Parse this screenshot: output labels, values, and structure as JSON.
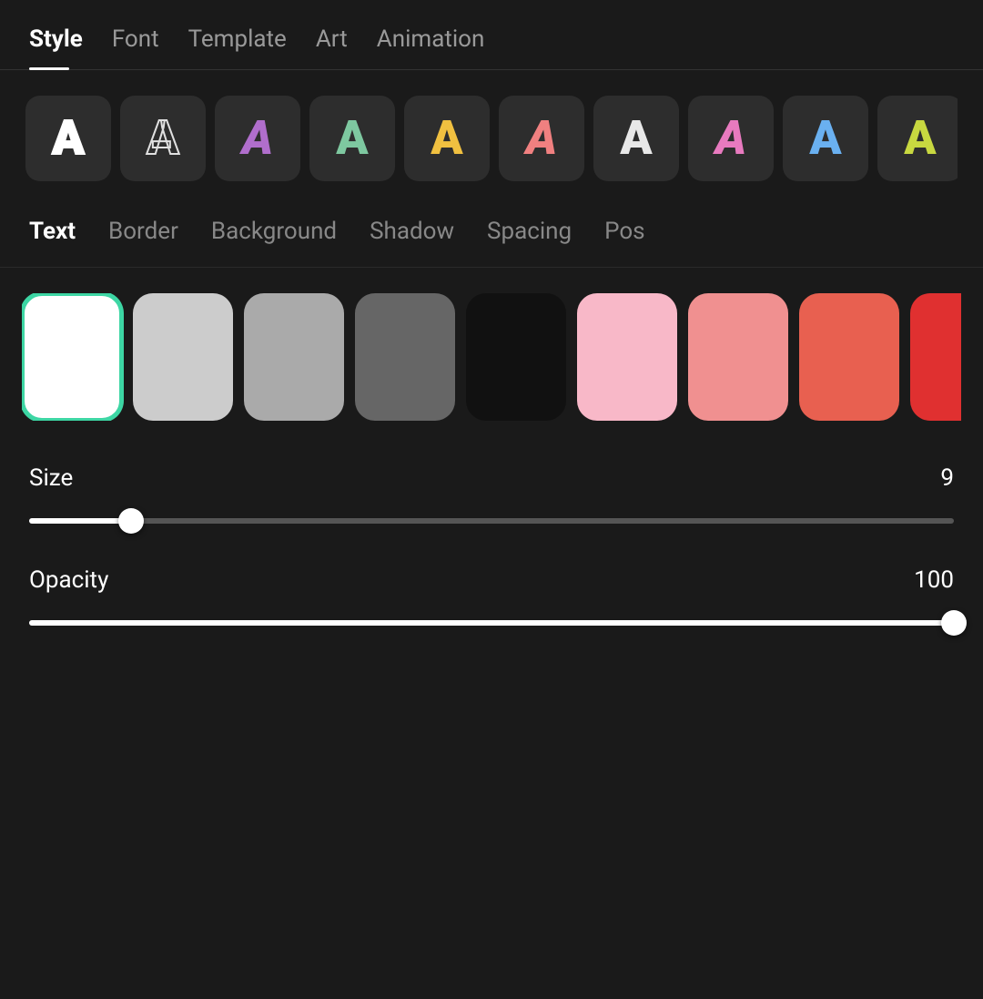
{
  "nav": {
    "items": [
      {
        "id": "style",
        "label": "Style",
        "active": true
      },
      {
        "id": "font",
        "label": "Font",
        "active": false
      },
      {
        "id": "template",
        "label": "Template",
        "active": false
      },
      {
        "id": "art",
        "label": "Art",
        "active": false
      },
      {
        "id": "animation",
        "label": "Animation",
        "active": false
      }
    ]
  },
  "fontStyles": {
    "items": [
      {
        "id": 1,
        "letter": "A",
        "styleClass": "letter-style-1"
      },
      {
        "id": 2,
        "letter": "A",
        "styleClass": "letter-style-2"
      },
      {
        "id": 3,
        "letter": "A",
        "styleClass": "letter-style-3"
      },
      {
        "id": 4,
        "letter": "A",
        "styleClass": "letter-style-4"
      },
      {
        "id": 5,
        "letter": "A",
        "styleClass": "letter-style-5"
      },
      {
        "id": 6,
        "letter": "A",
        "styleClass": "letter-style-6"
      },
      {
        "id": 7,
        "letter": "A",
        "styleClass": "letter-style-7"
      },
      {
        "id": 8,
        "letter": "A",
        "styleClass": "letter-style-8"
      },
      {
        "id": 9,
        "letter": "A",
        "styleClass": "letter-style-9"
      },
      {
        "id": 10,
        "letter": "A",
        "styleClass": "letter-style-10"
      }
    ]
  },
  "subNav": {
    "items": [
      {
        "id": "text",
        "label": "Text",
        "active": true
      },
      {
        "id": "border",
        "label": "Border",
        "active": false
      },
      {
        "id": "background",
        "label": "Background",
        "active": false
      },
      {
        "id": "shadow",
        "label": "Shadow",
        "active": false
      },
      {
        "id": "spacing",
        "label": "Spacing",
        "active": false
      },
      {
        "id": "position",
        "label": "Pos",
        "active": false
      }
    ]
  },
  "colorSwatches": {
    "colors": [
      {
        "id": "white",
        "class": "swatch-white",
        "selected": true
      },
      {
        "id": "light-gray",
        "class": "swatch-light-gray",
        "selected": false
      },
      {
        "id": "gray",
        "class": "swatch-gray",
        "selected": false
      },
      {
        "id": "dark-gray",
        "class": "swatch-dark-gray",
        "selected": false
      },
      {
        "id": "black",
        "class": "swatch-black",
        "selected": false
      },
      {
        "id": "light-pink",
        "class": "swatch-light-pink",
        "selected": false
      },
      {
        "id": "salmon",
        "class": "swatch-salmon",
        "selected": false
      },
      {
        "id": "coral",
        "class": "swatch-coral",
        "selected": false
      },
      {
        "id": "red",
        "class": "swatch-red",
        "selected": false
      }
    ]
  },
  "sliders": {
    "size": {
      "label": "Size",
      "value": 9,
      "min": 0,
      "max": 100,
      "position_percent": 11
    },
    "opacity": {
      "label": "Opacity",
      "value": 100,
      "min": 0,
      "max": 100,
      "position_percent": 100
    }
  }
}
